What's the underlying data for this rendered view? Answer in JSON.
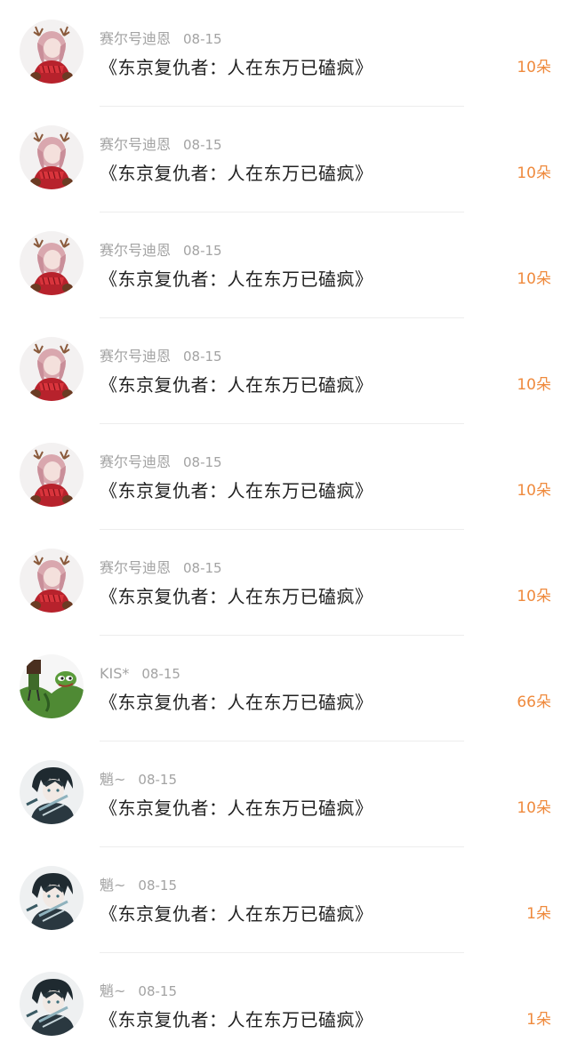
{
  "gifts": [
    {
      "user": "赛尔号迪恩",
      "date": "08-15",
      "book": "《东京复仇者：人在东万已磕疯》",
      "amount": "10朵",
      "avatar": "deer-girl"
    },
    {
      "user": "赛尔号迪恩",
      "date": "08-15",
      "book": "《东京复仇者：人在东万已磕疯》",
      "amount": "10朵",
      "avatar": "deer-girl"
    },
    {
      "user": "赛尔号迪恩",
      "date": "08-15",
      "book": "《东京复仇者：人在东万已磕疯》",
      "amount": "10朵",
      "avatar": "deer-girl"
    },
    {
      "user": "赛尔号迪恩",
      "date": "08-15",
      "book": "《东京复仇者：人在东万已磕疯》",
      "amount": "10朵",
      "avatar": "deer-girl"
    },
    {
      "user": "赛尔号迪恩",
      "date": "08-15",
      "book": "《东京复仇者：人在东万已磕疯》",
      "amount": "10朵",
      "avatar": "deer-girl"
    },
    {
      "user": "赛尔号迪恩",
      "date": "08-15",
      "book": "《东京复仇者：人在东万已磕疯》",
      "amount": "10朵",
      "avatar": "deer-girl"
    },
    {
      "user": "KIS*",
      "date": "08-15",
      "book": "《东京复仇者：人在东万已磕疯》",
      "amount": "66朵",
      "avatar": "green-frog"
    },
    {
      "user": "魈~",
      "date": "08-15",
      "book": "《东京复仇者：人在东万已磕疯》",
      "amount": "10朵",
      "avatar": "dark-hair-boy"
    },
    {
      "user": "魈~",
      "date": "08-15",
      "book": "《东京复仇者：人在东万已磕疯》",
      "amount": "1朵",
      "avatar": "dark-hair-boy"
    },
    {
      "user": "魈~",
      "date": "08-15",
      "book": "《东京复仇者：人在东万已磕疯》",
      "amount": "1朵",
      "avatar": "dark-hair-boy"
    }
  ],
  "colors": {
    "accent": "#ef8a3d",
    "meta": "#a3a3a3",
    "title": "#222222"
  }
}
